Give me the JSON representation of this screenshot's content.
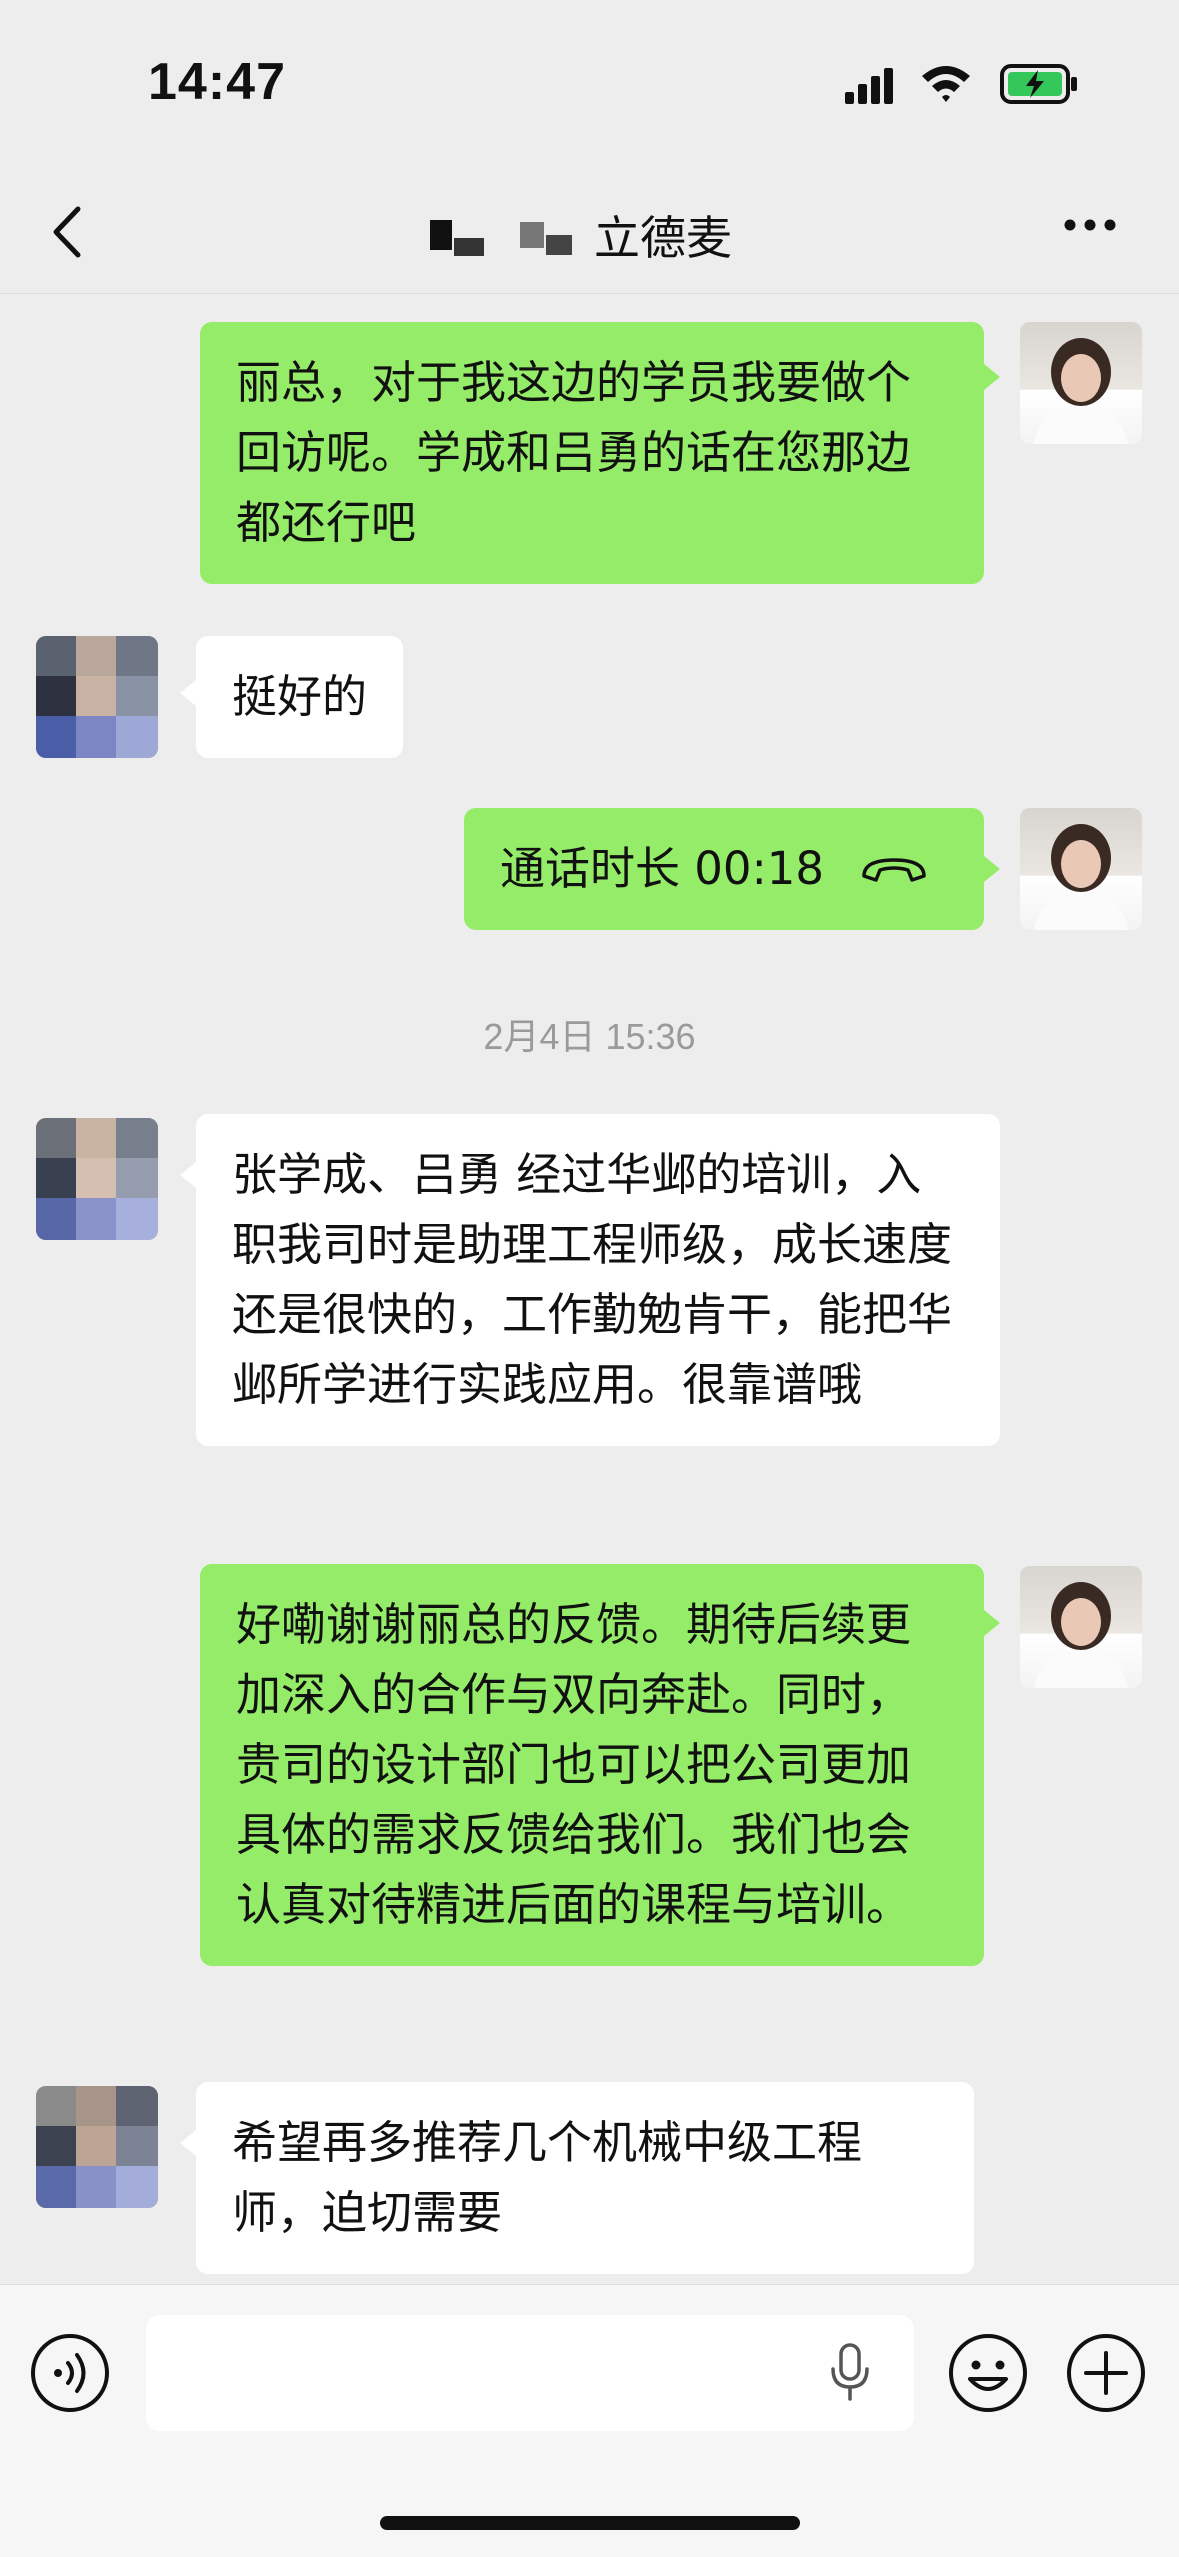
{
  "status_bar": {
    "time": "14:47"
  },
  "header": {
    "title": "立德麦"
  },
  "messages": [
    {
      "side": "me",
      "text": "丽总，对于我这边的学员我要做个回访呢。学成和吕勇的话在您那边都还行吧"
    },
    {
      "side": "other",
      "text": "挺好的"
    },
    {
      "side": "me",
      "type": "call",
      "text": "通话时长 00:18"
    },
    {
      "type": "timestamp",
      "text": "2月4日 15:36"
    },
    {
      "side": "other",
      "text": "张学成、吕勇 经过华邺的培训，入职我司时是助理工程师级，成长速度还是很快的，工作勤勉肯干，能把华邺所学进行实践应用。很靠谱哦"
    },
    {
      "side": "me",
      "text": "好嘞谢谢丽总的反馈。期待后续更加深入的合作与双向奔赴。同时，贵司的设计部门也可以把公司更加具体的需求反馈给我们。我们也会认真对待精进后面的课程与培训。"
    },
    {
      "side": "other",
      "text": "希望再多推荐几个机械中级工程师，迫切需要"
    }
  ],
  "input": {
    "placeholder": ""
  },
  "colors": {
    "my_bubble": "#95ec69",
    "their_bubble": "#ffffff",
    "background": "#ededed"
  }
}
